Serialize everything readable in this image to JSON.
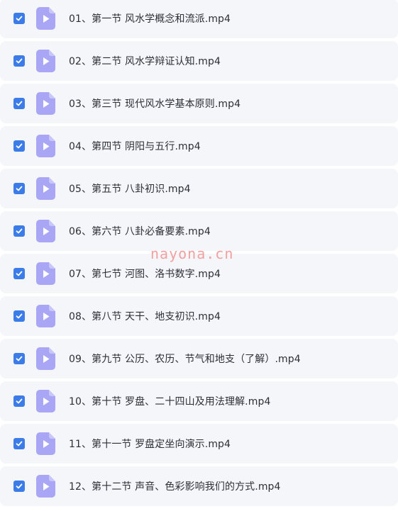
{
  "files": [
    {
      "name": "01、第一节 风水学概念和流派.mp4",
      "checked": true
    },
    {
      "name": "02、第二节 风水学辩证认知.mp4",
      "checked": true
    },
    {
      "name": "03、第三节 现代风水学基本原则.mp4",
      "checked": true
    },
    {
      "name": "04、第四节 阴阳与五行.mp4",
      "checked": true
    },
    {
      "name": "05、第五节 八卦初识.mp4",
      "checked": true
    },
    {
      "name": "06、第六节 八卦必备要素.mp4",
      "checked": true
    },
    {
      "name": "07、第七节 河图、洛书数字.mp4",
      "checked": true
    },
    {
      "name": "08、第八节 天干、地支初识.mp4",
      "checked": true
    },
    {
      "name": "09、第九节 公历、农历、节气和地支（了解）.mp4",
      "checked": true
    },
    {
      "name": "10、第十节 罗盘、二十四山及用法理解.mp4",
      "checked": true
    },
    {
      "name": "11、第十一节 罗盘定坐向演示.mp4",
      "checked": true
    },
    {
      "name": "12、第十二节 声音、色彩影响我们的方式.mp4",
      "checked": true
    }
  ],
  "icons": {
    "checkbox": "checkbox-checked-icon",
    "file": "video-file-icon"
  },
  "colors": {
    "row_background": "#f5f6fa",
    "checkbox": "#3b7ce8",
    "file_icon": "#a9a6f5",
    "text": "#2b2f36",
    "watermark": "#f2a0a0"
  },
  "watermark": "nayona.cn"
}
